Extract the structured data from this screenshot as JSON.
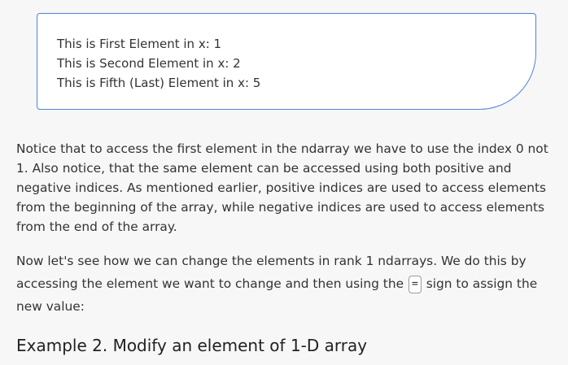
{
  "output": {
    "lines": [
      "This is First Element in x: 1",
      "This is Second Element in x: 2",
      "This is Fifth (Last) Element in x: 5"
    ]
  },
  "content": {
    "paragraph1": "Notice that to access the first element in the ndarray we have to use the index 0 not 1. Also notice, that the same element can be accessed using both positive and negative indices. As mentioned earlier, positive indices are used to access elements from the beginning of the array, while negative indices are used to access elements from the end of the array.",
    "paragraph2_before": "Now let's see how we can change the elements in rank 1 ndarrays. We do this by accessing the element we want to change and then using the",
    "paragraph2_code": "=",
    "paragraph2_after": "sign to assign the new value:",
    "heading": "Example 2. Modify an element of 1-D array"
  }
}
